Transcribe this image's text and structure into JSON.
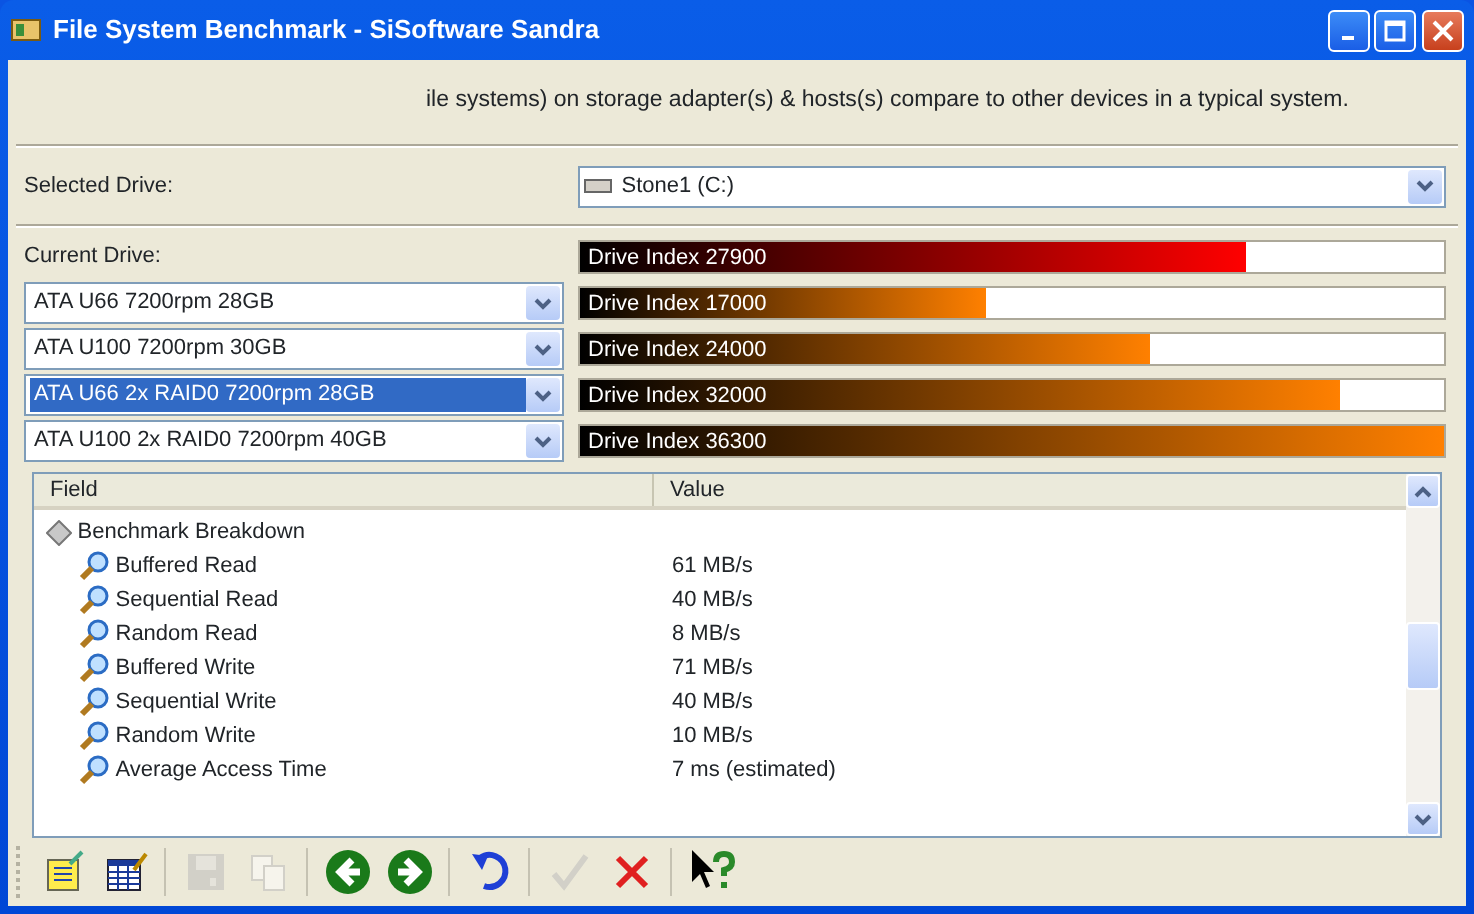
{
  "window": {
    "title": "File System Benchmark - SiSoftware Sandra"
  },
  "description": "ile systems) on storage adapter(s) & hosts(s) compare to other devices in a typical system.",
  "selected_drive": {
    "label": "Selected Drive:",
    "value": "Stone1 (C:)"
  },
  "current_drive": {
    "label": "Current Drive:",
    "bar": {
      "text": "Drive Index 27900",
      "level": 0.77,
      "color": "#ff0000"
    }
  },
  "comparisons": [
    {
      "drive": "ATA U66 7200rpm 28GB",
      "selected": false,
      "bar": {
        "text": "Drive Index 17000",
        "level": 0.47,
        "color": "#ff8000"
      }
    },
    {
      "drive": "ATA U100 7200rpm 30GB",
      "selected": false,
      "bar": {
        "text": "Drive Index 24000",
        "level": 0.66,
        "color": "#ff8000"
      }
    },
    {
      "drive": "ATA U66 2x RAID0 7200rpm 28GB",
      "selected": true,
      "bar": {
        "text": "Drive Index 32000",
        "level": 0.88,
        "color": "#ff8000"
      }
    },
    {
      "drive": "ATA U100 2x RAID0 7200rpm 40GB",
      "selected": false,
      "bar": {
        "text": "Drive Index 36300",
        "level": 1.0,
        "color": "#ff8000"
      }
    }
  ],
  "table": {
    "columns": [
      "Field",
      "Value"
    ],
    "rows": [
      {
        "field": "Benchmark Breakdown",
        "value": "",
        "children": [
          {
            "field": "Buffered Read",
            "value": "61 MB/s"
          },
          {
            "field": "Sequential Read",
            "value": "40 MB/s"
          },
          {
            "field": "Random Read",
            "value": "8 MB/s"
          },
          {
            "field": "Buffered Write",
            "value": "71 MB/s"
          },
          {
            "field": "Sequential Write",
            "value": "40 MB/s"
          },
          {
            "field": "Random Write",
            "value": "10 MB/s"
          },
          {
            "field": "Average Access Time",
            "value": "7 ms (estimated)"
          }
        ]
      }
    ]
  },
  "toolbar": [
    {
      "kind": "notes",
      "disabled": false
    },
    {
      "kind": "table",
      "disabled": false
    },
    {
      "kind": "sep"
    },
    {
      "kind": "save",
      "disabled": true
    },
    {
      "kind": "copy",
      "disabled": true
    },
    {
      "kind": "sep"
    },
    {
      "kind": "back",
      "disabled": false
    },
    {
      "kind": "forward",
      "disabled": false
    },
    {
      "kind": "sep"
    },
    {
      "kind": "undo",
      "disabled": false
    },
    {
      "kind": "sep"
    },
    {
      "kind": "ok",
      "disabled": true
    },
    {
      "kind": "cancel",
      "disabled": false
    },
    {
      "kind": "sep"
    },
    {
      "kind": "help",
      "disabled": false
    }
  ]
}
